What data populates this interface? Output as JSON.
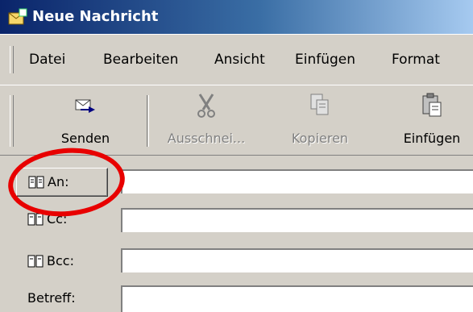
{
  "window": {
    "title": "Neue Nachricht"
  },
  "menu": [
    "Datei",
    "Bearbeiten",
    "Ansicht",
    "Einfügen",
    "Format"
  ],
  "toolbar": {
    "send": "Senden",
    "cut": "Ausschnei...",
    "copy": "Kopieren",
    "paste": "Einfügen"
  },
  "header_fields": {
    "to": "An:",
    "cc": "Cc:",
    "bcc": "Bcc:",
    "subject": "Betreff:"
  },
  "colors": {
    "annotation_circle": "#e80000",
    "title_bar": "#0a246a"
  },
  "icons": [
    "envelope-icon",
    "send-icon",
    "scissors-icon",
    "copy-icon",
    "paste-icon",
    "address-book-icon"
  ]
}
